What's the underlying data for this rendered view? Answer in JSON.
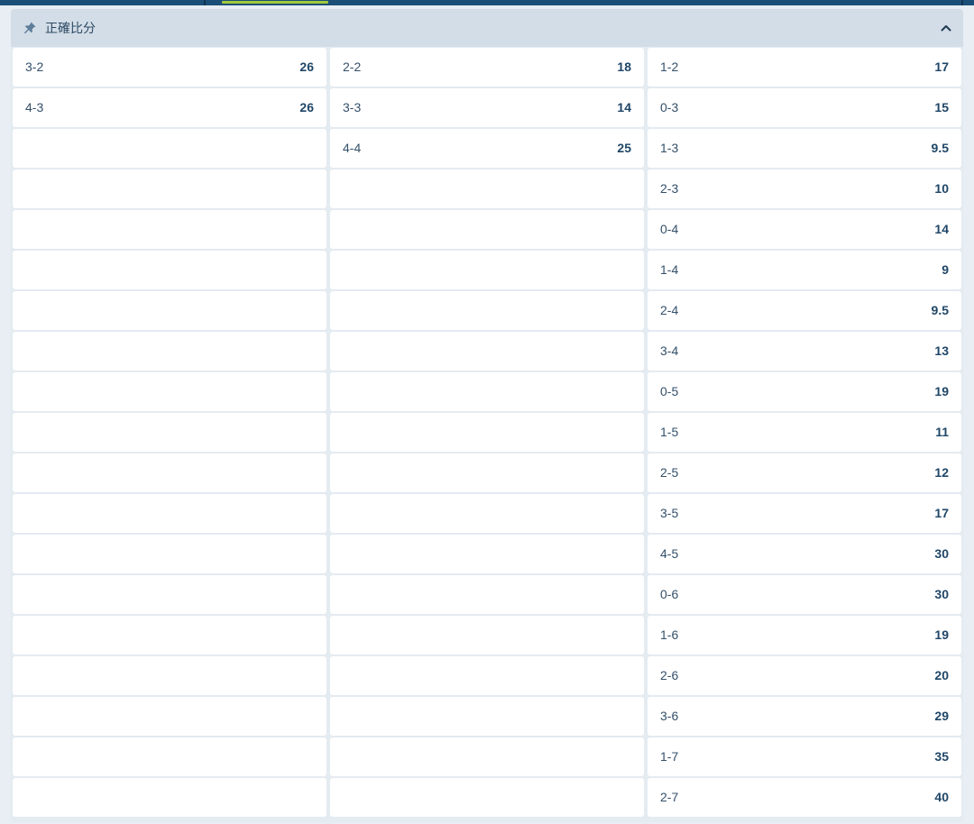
{
  "market": {
    "title": "正確比分",
    "icons": {
      "pin": "pin-icon",
      "collapse": "chevron-up-icon"
    },
    "columns": [
      [
        {
          "score": "3-2",
          "odds": "26"
        },
        {
          "score": "4-3",
          "odds": "26"
        }
      ],
      [
        {
          "score": "2-2",
          "odds": "18"
        },
        {
          "score": "3-3",
          "odds": "14"
        },
        {
          "score": "4-4",
          "odds": "25"
        }
      ],
      [
        {
          "score": "1-2",
          "odds": "17"
        },
        {
          "score": "0-3",
          "odds": "15"
        },
        {
          "score": "1-3",
          "odds": "9.5"
        },
        {
          "score": "2-3",
          "odds": "10"
        },
        {
          "score": "0-4",
          "odds": "14"
        },
        {
          "score": "1-4",
          "odds": "9"
        },
        {
          "score": "2-4",
          "odds": "9.5"
        },
        {
          "score": "3-4",
          "odds": "13"
        },
        {
          "score": "0-5",
          "odds": "19"
        },
        {
          "score": "1-5",
          "odds": "11"
        },
        {
          "score": "2-5",
          "odds": "12"
        },
        {
          "score": "3-5",
          "odds": "17"
        },
        {
          "score": "4-5",
          "odds": "30"
        },
        {
          "score": "0-6",
          "odds": "30"
        },
        {
          "score": "1-6",
          "odds": "19"
        },
        {
          "score": "2-6",
          "odds": "20"
        },
        {
          "score": "3-6",
          "odds": "29"
        },
        {
          "score": "1-7",
          "odds": "35"
        },
        {
          "score": "2-7",
          "odds": "40"
        }
      ]
    ]
  },
  "colors": {
    "header_bg": "#d3dde7",
    "cell_bg": "#ffffff",
    "odds_text": "#1f4667",
    "accent": "#a3c93a",
    "topbar": "#1c4f78"
  }
}
